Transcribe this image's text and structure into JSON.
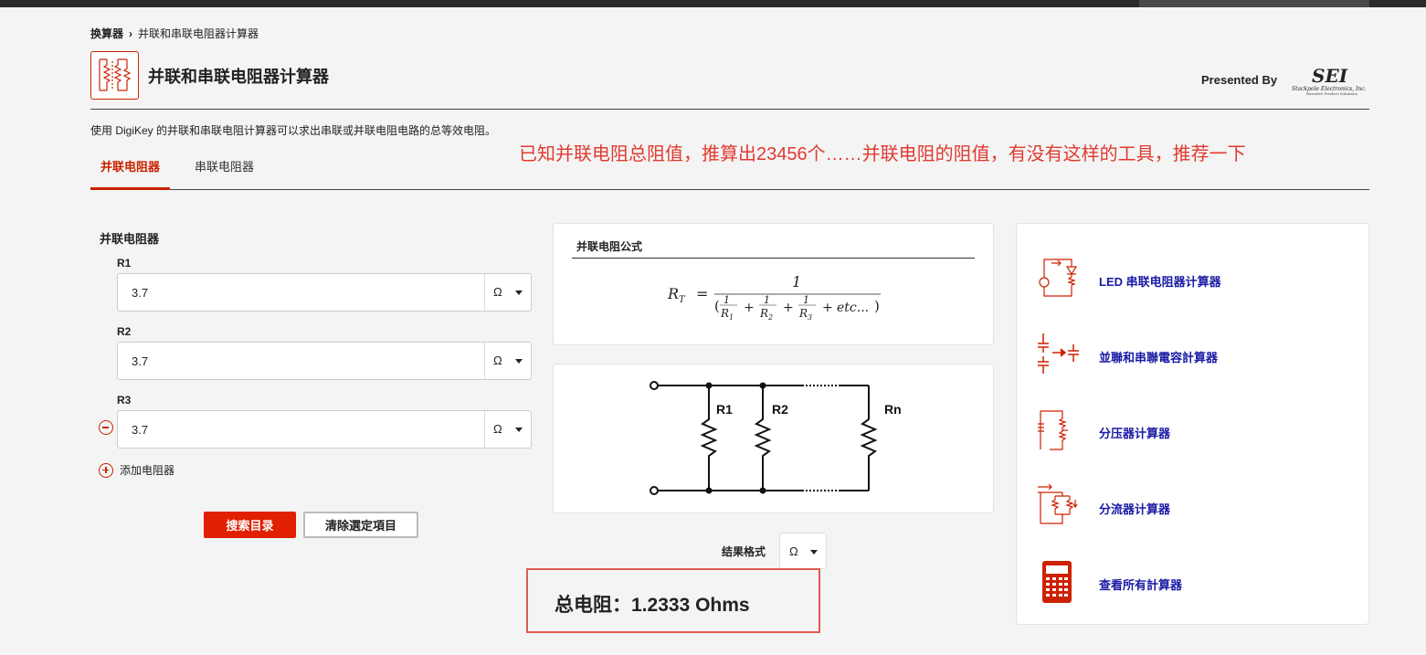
{
  "breadcrumb": {
    "root": "换算器",
    "separator": "›",
    "current": "并联和串联电阻器计算器"
  },
  "page_title": "并联和串联电阻器计算器",
  "presented_by": "Presented By",
  "logo": {
    "text": "SEI",
    "subtitle": "Stackpole Electronics, Inc.",
    "tagline": "Resistive Product Solutions"
  },
  "description": "使用 DigiKey 的并联和串联电阻计算器可以求出串联或并联电阻电路的总等效电阻。",
  "annotation": "已知并联电阻总阻值，推算出23456个……并联电阻的阻值，有没有这样的工具，推荐一下",
  "tabs": [
    {
      "label": "并联电阻器",
      "active": true
    },
    {
      "label": "串联电阻器",
      "active": false
    }
  ],
  "calculator": {
    "section_label": "并联电阻器",
    "resistors": [
      {
        "label": "R1",
        "value": "3.7",
        "unit": "Ω"
      },
      {
        "label": "R2",
        "value": "3.7",
        "unit": "Ω"
      },
      {
        "label": "R3",
        "value": "3.7",
        "unit": "Ω"
      }
    ],
    "add_label": "添加电阻器",
    "search_button": "搜索目录",
    "clear_button": "清除選定項目"
  },
  "formula": {
    "title": "并联电阻公式"
  },
  "diagram": {
    "labels": [
      "R1",
      "R2",
      "Rn"
    ]
  },
  "result": {
    "format_label": "结果格式",
    "format_unit": "Ω",
    "text": "总电阻：1.2333 Ohms"
  },
  "side_links": [
    {
      "label": "LED 串联电阻器计算器",
      "icon": "led-circuit-icon"
    },
    {
      "label": "並聯和串聯電容計算器",
      "icon": "capacitor-icon"
    },
    {
      "label": "分压器计算器",
      "icon": "voltage-divider-icon"
    },
    {
      "label": "分流器计算器",
      "icon": "current-divider-icon"
    },
    {
      "label": "查看所有計算器",
      "icon": "calculator-icon"
    }
  ],
  "colors": {
    "accent": "#cc2200",
    "link": "#1a1aa6",
    "annotation": "#e03a2f"
  }
}
